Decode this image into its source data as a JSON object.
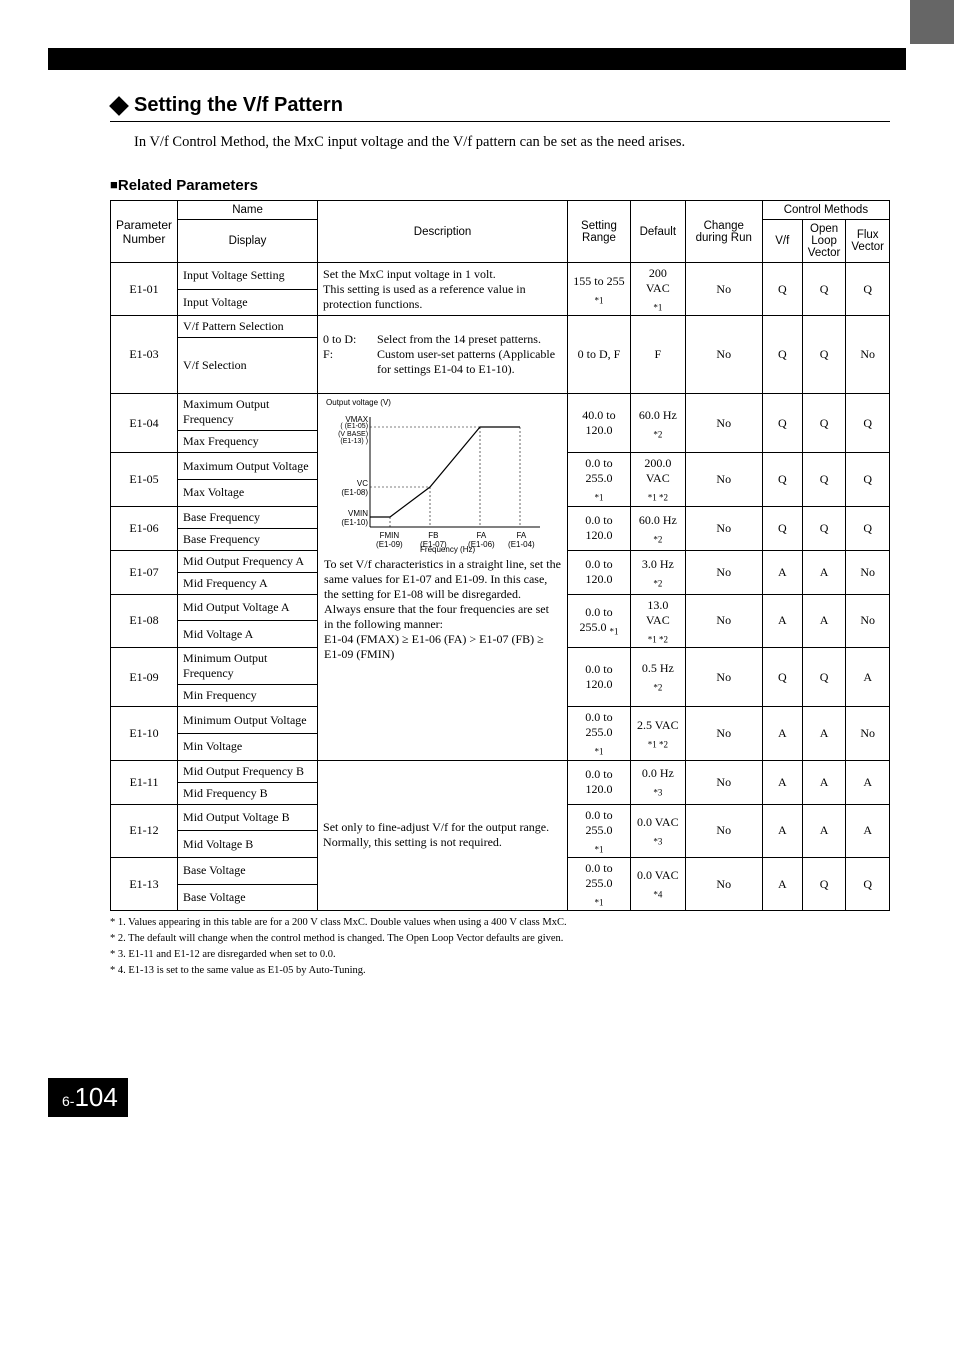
{
  "title": "Setting the V/f Pattern",
  "intro": "In V/f Control Method, the MxC input voltage and the V/f pattern can be set as the need arises.",
  "subTitle": "Related Parameters",
  "headers": {
    "paramNum": "Parameter Number",
    "name": "Name",
    "display": "Display",
    "description": "Description",
    "range": "Setting Range",
    "default": "Default",
    "change": "Change during Run",
    "controlMethods": "Control Methods",
    "vf": "V/f",
    "olv": "Open Loop Vector",
    "flux": "Flux Vector"
  },
  "graph": {
    "yLabel": "Output voltage (V)",
    "vmax": "VMAX",
    "vmaxSub": "(E1-05)\n(V BASE)\n(E1-13)",
    "vc": "VC",
    "vcSub": "(E1-08)",
    "vmin": "VMIN",
    "vminSub": "(E1-10)",
    "fmin": "FMIN",
    "fminSub": "(E1-09)",
    "fb": "FB",
    "fbSub": "(E1-07)",
    "fa1": "FA",
    "fa1Sub": "(E1-06)",
    "fa2": "FA",
    "fa2Sub": "(E1-04)",
    "xLabel": "Frequency (Hz)"
  },
  "rows": {
    "e101": {
      "num": "E1-01",
      "name": "Input Voltage Setting",
      "display": "Input Voltage",
      "desc1": "Set the MxC input voltage in 1 volt.",
      "desc2": "This setting is used as a reference value in protection functions.",
      "range": "155 to 255",
      "rangeSub": "*1",
      "def": "200 VAC",
      "defSub": "*1",
      "chg": "No",
      "vf": "Q",
      "olv": "Q",
      "flux": "Q"
    },
    "e103": {
      "num": "E1-03",
      "name": "V/f Pattern Selection",
      "display": "V/f Selection",
      "desc_k1": "0 to D:",
      "desc_v1": "Select from the 14 preset patterns.",
      "desc_k2": "F:",
      "desc_v2": "Custom user-set patterns (Applicable for settings E1-04 to E1-10).",
      "range": "0 to D, F",
      "def": "F",
      "chg": "No",
      "vf": "Q",
      "olv": "Q",
      "flux": "No"
    },
    "e104": {
      "num": "E1-04",
      "name": "Maximum Output Frequency",
      "display": "Max Frequency",
      "range": "40.0 to 120.0",
      "def": "60.0 Hz",
      "defSub": "*2",
      "chg": "No",
      "vf": "Q",
      "olv": "Q",
      "flux": "Q"
    },
    "e105": {
      "num": "E1-05",
      "name": "Maximum Output Voltage",
      "display": "Max Voltage",
      "range": "0.0 to 255.0",
      "rangeSub": "*1",
      "def": "200.0 VAC",
      "defSub": "*1 *2",
      "chg": "No",
      "vf": "Q",
      "olv": "Q",
      "flux": "Q"
    },
    "e106": {
      "num": "E1-06",
      "name": "Base Frequency",
      "display": "Base Frequency",
      "range": "0.0 to 120.0",
      "def": "60.0 Hz",
      "defSub": "*2",
      "chg": "No",
      "vf": "Q",
      "olv": "Q",
      "flux": "Q"
    },
    "e107": {
      "num": "E1-07",
      "name": "Mid Output Frequency A",
      "display": "Mid Frequency A",
      "range": "0.0 to 120.0",
      "def": "3.0 Hz",
      "defSub": "*2",
      "chg": "No",
      "vf": "A",
      "olv": "A",
      "flux": "No"
    },
    "e108": {
      "num": "E1-08",
      "name": "Mid Output Voltage A",
      "display": "Mid Voltage A",
      "range": "0.0 to 255.0 ",
      "rangeSub": "*1",
      "def": "13.0 VAC",
      "defSub": "*1 *2",
      "chg": "No",
      "vf": "A",
      "olv": "A",
      "flux": "No"
    },
    "e109": {
      "num": "E1-09",
      "name": "Minimum Output Frequency",
      "display": "Min Frequency",
      "range": "0.0 to 120.0",
      "def": "0.5 Hz",
      "defSub": "*2",
      "chg": "No",
      "vf": "Q",
      "olv": "Q",
      "flux": "A"
    },
    "e110": {
      "num": "E1-10",
      "name": "Minimum Output Voltage",
      "display": "Min Voltage",
      "range": "0.0 to 255.0",
      "rangeSub": "*1",
      "def": "2.5 VAC",
      "defSub": "*1 *2",
      "chg": "No",
      "vf": "A",
      "olv": "A",
      "flux": "No"
    },
    "e111": {
      "num": "E1-11",
      "name": "Mid Output Frequency B",
      "display": "Mid Frequency B",
      "range": "0.0 to 120.0",
      "def": "0.0 Hz",
      "defSub": "*3",
      "chg": "No",
      "vf": "A",
      "olv": "A",
      "flux": "A"
    },
    "e112": {
      "num": "E1-12",
      "name": "Mid Output Voltage B",
      "display": "Mid Voltage B",
      "desc": "Set only to fine-adjust V/f for the output range. Normally, this setting is not required.",
      "range": "0.0 to 255.0",
      "rangeSub": "*1",
      "def": "0.0 VAC",
      "defSub": "*3",
      "chg": "No",
      "vf": "A",
      "olv": "A",
      "flux": "A"
    },
    "e113": {
      "num": "E1-13",
      "name": "Base Voltage",
      "display": "Base Voltage",
      "range": "0.0 to 255.0",
      "rangeSub": "*1",
      "def": "0.0 VAC",
      "defSub": "*4",
      "chg": "No",
      "vf": "A",
      "olv": "Q",
      "flux": "Q"
    }
  },
  "sharedDesc": {
    "line1": "To set V/f characteristics in a straight line, set the same values for E1-07 and E1-09. In this case, the setting for E1-08 will be disregarded.",
    "line2": "Always ensure that the four frequencies are set in the following manner:",
    "line3": "E1-04 (FMAX) ≥ E1-06 (FA) > E1-07 (FB) ≥ E1-09 (FMIN)"
  },
  "footnotes": {
    "f1": "* 1. Values appearing in this table are for a 200 V class MxC. Double values when using a 400 V class MxC.",
    "f2": "* 2. The default will change when the control method is changed. The Open Loop Vector defaults are given.",
    "f3": "* 3. E1-11 and E1-12 are disregarded when set to 0.0.",
    "f4": "* 4. E1-13 is set to the same value as E1-05 by Auto-Tuning."
  },
  "pageNum": {
    "chapter": "6-",
    "page": "104"
  }
}
